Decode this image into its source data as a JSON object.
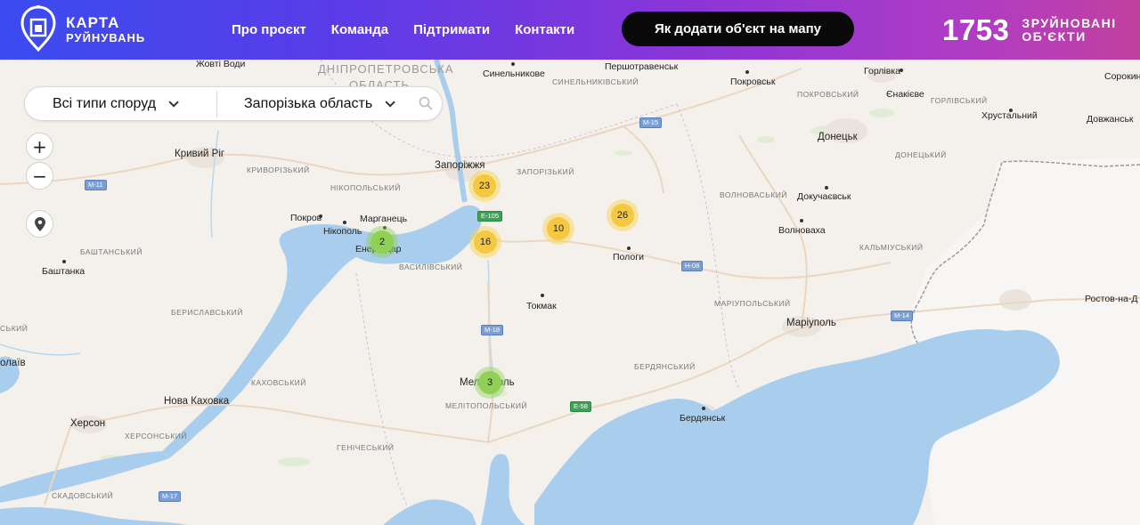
{
  "header": {
    "logo_line1": "КАРТА",
    "logo_line2": "РУЙНУВАНЬ",
    "nav": [
      "Про проєкт",
      "Команда",
      "Підтримати",
      "Контакти"
    ],
    "add_button": "Як додати об'єкт на мапу",
    "counter_value": "1753",
    "counter_label_line1": "ЗРУЙНОВАНІ",
    "counter_label_line2": "ОБ'ЄКТИ"
  },
  "filters": {
    "type": "Всі типи споруд",
    "region": "Запорізька область"
  },
  "controls": {
    "zoom_in": "+",
    "zoom_out": "−"
  },
  "clusters": [
    {
      "count": "23",
      "color": "yellow"
    },
    {
      "count": "26",
      "color": "yellow"
    },
    {
      "count": "10",
      "color": "yellow"
    },
    {
      "count": "16",
      "color": "yellow"
    },
    {
      "count": "2",
      "color": "green"
    },
    {
      "count": "3",
      "color": "green"
    }
  ],
  "labels": {
    "zhovti_vody": "Жовті Води",
    "dnipro_oblast_1": "ДНІПРОПЕТРОВСЬКА",
    "dnipro_oblast_2": "ОБЛАСТЬ",
    "synelnykove": "Синельникове",
    "synelnykivskyi": "СИНЕЛЬНИКІВСЬКИЙ",
    "pershotravensk": "Першотравенськ",
    "pokrovsk": "Покровськ",
    "pokrovskyi": "ПОКРОВСЬКИЙ",
    "horlivka": "Горлівка",
    "yenakiieve": "Єнакієве",
    "horlivskyi": "ГОРЛІВСЬКИЙ",
    "khrustalnyi": "Хрустальний",
    "sorokyne": "Сорокин",
    "dovzhansk": "Довжанськ",
    "donetsk": "Донецьк",
    "donetskyi": "ДОНЕЦЬКИЙ",
    "kryvyi_rih": "Кривий Ріг",
    "kryvorizkyi": "КРИВОРІЗЬКИЙ",
    "zaporizhzhia": "Запоріжжя",
    "zaporizkyi": "ЗАПОРІЗЬКИЙ",
    "nikopolskyi": "НІКОПОЛЬСЬКИЙ",
    "volnovaskyi": "ВОЛНОВАСЬКИЙ",
    "dokuchaievsk": "Докучаєвськ",
    "pokrov": "Покров",
    "nikopol": "Нікополь",
    "marhanets": "Марганець",
    "volnovakha": "Волноваха",
    "enerhodar": "Енергодар",
    "bashtanskyi": "БАШТАНСЬКИЙ",
    "vasylivskyi": "ВАСИЛІВСЬКИЙ",
    "polohy": "Пологи",
    "kalmiuskyi": "КАЛЬМІУСЬКИЙ",
    "bashtanka": "Баштанка",
    "tokmak": "Токмак",
    "rostov": "Ростов-на-Д",
    "beryslavskyi": "БЕРИСЛАВСЬКИЙ",
    "mariupolskyi": "МАРІУПОЛЬСЬКИЙ",
    "mariupol": "Маріуполь",
    "mykolaiv_cut": "олаїв",
    "kyi_cut": "СЬКИЙ",
    "berdianskyi": "БЕРДЯНСЬКИЙ",
    "kakhovskyi": "КАХОВСЬКИЙ",
    "melitopol": "Мелітополь",
    "nova_kakhovka": "Нова Каховка",
    "melitopolskyi": "МЕЛІТОПОЛЬСЬКИЙ",
    "berdiansk": "Бердянськ",
    "kherson": "Херсон",
    "khersonskyi": "ХЕРСОНСЬКИЙ",
    "henicheskyi": "ГЕНІЧЕСЬКИЙ",
    "skadovskyi": "СКАДОВСЬКИЙ"
  },
  "roads": {
    "m11": "M-11",
    "m15": "M-15",
    "e105": "E-105",
    "m08": "H-08",
    "m18": "M-18",
    "m14": "M-14",
    "e58": "E-58",
    "m17": "M-17"
  },
  "colors": {
    "header_start": "#3a4cf0",
    "header_end": "#c1409e",
    "water": "#a9cdec",
    "land": "#f4f1ec",
    "cluster_yellow": "#f5c842",
    "cluster_green": "#8fd055"
  }
}
